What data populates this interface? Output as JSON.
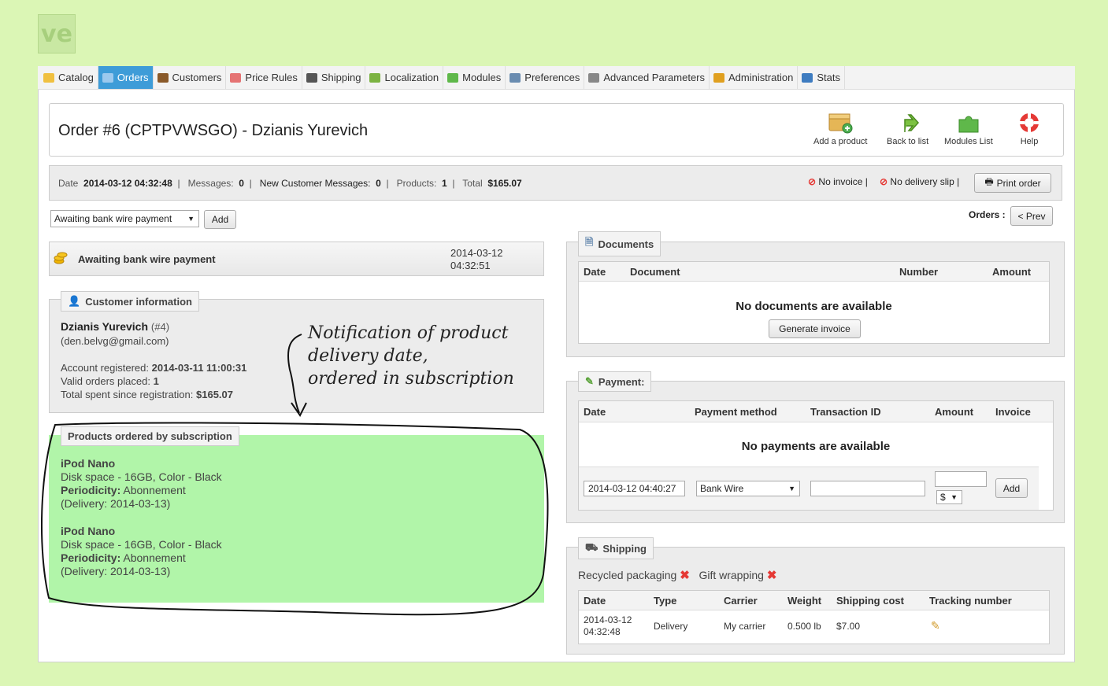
{
  "logo": {
    "text": "ve"
  },
  "nav": [
    {
      "label": "Catalog",
      "icon": "folder-icon",
      "active": false
    },
    {
      "label": "Orders",
      "icon": "cart-icon",
      "active": true
    },
    {
      "label": "Customers",
      "icon": "user-icon",
      "active": false
    },
    {
      "label": "Price Rules",
      "icon": "price-tag-icon",
      "active": false
    },
    {
      "label": "Shipping",
      "icon": "truck-icon",
      "active": false
    },
    {
      "label": "Localization",
      "icon": "globe-icon",
      "active": false
    },
    {
      "label": "Modules",
      "icon": "puzzle-icon",
      "active": false
    },
    {
      "label": "Preferences",
      "icon": "preferences-icon",
      "active": false
    },
    {
      "label": "Advanced Parameters",
      "icon": "wrench-icon",
      "active": false
    },
    {
      "label": "Administration",
      "icon": "key-icon",
      "active": false
    },
    {
      "label": "Stats",
      "icon": "bar-chart-icon",
      "active": false
    }
  ],
  "header": {
    "title": "Order #6 (CPTPVWSGO) - Dzianis Yurevich",
    "toolbar": {
      "add_product": "Add a product",
      "back_to_list": "Back to list",
      "modules_list": "Modules List",
      "help": "Help"
    }
  },
  "summary": {
    "date_label": "Date",
    "date": "2014-03-12 04:32:48",
    "messages_label": "Messages:",
    "messages": "0",
    "new_messages_label": "New Customer Messages:",
    "new_messages": "0",
    "products_label": "Products:",
    "products": "1",
    "total_label": "Total",
    "total": "$165.07",
    "no_invoice": "No invoice |",
    "no_delivery_slip": "No delivery slip |",
    "print_order": "Print order"
  },
  "status_select": {
    "value": "Awaiting bank wire payment",
    "add": "Add"
  },
  "orders_nav": {
    "label": "Orders :",
    "prev": "< Prev"
  },
  "status_history": {
    "status": "Awaiting bank wire payment",
    "date": "2014-03-12",
    "time": "04:32:51"
  },
  "customer": {
    "legend": "Customer information",
    "name": "Dzianis Yurevich",
    "id": "(#4)",
    "email": "(den.belvg@gmail.com)",
    "registered_label": "Account registered:",
    "registered": "2014-03-11 11:00:31",
    "valid_orders_label": "Valid orders placed:",
    "valid_orders": "1",
    "total_spent_label": "Total spent since registration:",
    "total_spent": "$165.07"
  },
  "annotation": {
    "line1": "Notification of product",
    "line2": "delivery date,",
    "line3": "ordered in subscription"
  },
  "subscription": {
    "legend": "Products ordered by subscription",
    "items": [
      {
        "name": "iPod Nano",
        "attrs": "Disk space - 16GB, Color - Black",
        "periodicity_label": "Periodicity:",
        "periodicity": "Abonnement",
        "delivery": "(Delivery: 2014-03-13)"
      },
      {
        "name": "iPod Nano",
        "attrs": "Disk space - 16GB, Color - Black",
        "periodicity_label": "Periodicity:",
        "periodicity": "Abonnement",
        "delivery": "(Delivery: 2014-03-13)"
      }
    ]
  },
  "documents": {
    "legend": "Documents",
    "columns": [
      "Date",
      "Document",
      "Number",
      "Amount"
    ],
    "empty": "No documents are available",
    "generate": "Generate invoice"
  },
  "payment": {
    "legend": "Payment:",
    "columns": [
      "Date",
      "Payment method",
      "Transaction ID",
      "Amount",
      "Invoice"
    ],
    "empty": "No payments are available",
    "date_value": "2014-03-12 04:40:27",
    "method": "Bank Wire",
    "transaction_id": "",
    "amount": "",
    "currency": "$",
    "add": "Add"
  },
  "shipping": {
    "legend": "Shipping",
    "recycled": "Recycled packaging",
    "gift": "Gift wrapping",
    "columns": [
      "Date",
      "Type",
      "Carrier",
      "Weight",
      "Shipping cost",
      "Tracking number"
    ],
    "row": {
      "date": "2014-03-12",
      "time": "04:32:48",
      "type": "Delivery",
      "carrier": "My carrier",
      "weight": "0.500 lb",
      "cost": "$7.00"
    }
  }
}
